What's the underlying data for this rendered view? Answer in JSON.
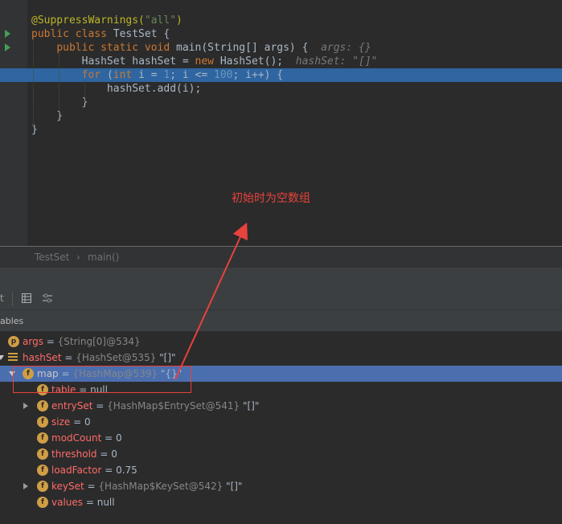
{
  "editor": {
    "lines": [
      {
        "segs": [
          [
            "ann",
            "@SuppressWarnings("
          ],
          [
            "str",
            "\"all\""
          ],
          [
            "ann",
            ")"
          ]
        ]
      },
      {
        "segs": [
          [
            "k",
            "public class "
          ],
          [
            "cls",
            "TestSet "
          ],
          [
            "plain",
            "{"
          ]
        ],
        "run": true
      },
      {
        "segs": [
          [
            "plain",
            "    "
          ],
          [
            "k",
            "public static void "
          ],
          [
            "fn",
            "main"
          ],
          [
            "plain",
            "("
          ],
          [
            "cls",
            "String"
          ],
          [
            "plain",
            "[] args) {  "
          ],
          [
            "hint",
            "args: {}"
          ]
        ],
        "run": true
      },
      {
        "segs": [
          [
            "plain",
            "        "
          ],
          [
            "cls",
            "HashSet"
          ],
          [
            "plain",
            " hashSet = "
          ],
          [
            "k",
            "new "
          ],
          [
            "cls",
            "HashSet"
          ],
          [
            "plain",
            "();  "
          ],
          [
            "hint",
            "hashSet: \"[]\""
          ]
        ]
      },
      {
        "segs": [
          [
            "plain",
            "        "
          ],
          [
            "k",
            "for "
          ],
          [
            "plain",
            "("
          ],
          [
            "k",
            "int "
          ],
          [
            "plain",
            "i = "
          ],
          [
            "num",
            "1"
          ],
          [
            "plain",
            "; i <= "
          ],
          [
            "num",
            "100"
          ],
          [
            "plain",
            "; i++) {"
          ]
        ],
        "highlight": true,
        "breakpoint": true
      },
      {
        "segs": [
          [
            "plain",
            "            hashSet."
          ],
          [
            "fn",
            "add"
          ],
          [
            "plain",
            "(i);"
          ]
        ]
      },
      {
        "segs": [
          [
            "plain",
            "        }"
          ]
        ]
      },
      {
        "segs": [
          [
            "plain",
            "    }"
          ]
        ]
      },
      {
        "segs": [
          [
            "plain",
            "}"
          ]
        ]
      }
    ]
  },
  "annotation": "初始时为空数组",
  "breadcrumb": {
    "class": "TestSet",
    "sep": "›",
    "method": "main()"
  },
  "variables_header": "ables",
  "tree": [
    {
      "indent": 0,
      "exp": "none",
      "icon": "p",
      "name": "args",
      "eq": " = ",
      "ref": "{String[0]@534}",
      "val": "",
      "red": true
    },
    {
      "indent": 0,
      "exp": "none",
      "icon": "lines",
      "name": "hashSet",
      "eq": " = ",
      "ref": "{HashSet@535}",
      "val": " \"[]\"",
      "red": true
    },
    {
      "indent": 1,
      "exp": "down",
      "icon": "f",
      "name": "map",
      "eq": " = ",
      "ref": "{HashMap@539}",
      "val": " \"{}\"",
      "red": false,
      "selected": true
    },
    {
      "indent": 2,
      "exp": "none",
      "icon": "f",
      "name": "table",
      "eq": " = ",
      "ref": "",
      "val": "null",
      "red": true
    },
    {
      "indent": 2,
      "exp": "right",
      "icon": "f",
      "name": "entrySet",
      "eq": " = ",
      "ref": "{HashMap$EntrySet@541}",
      "val": " \"[]\"",
      "red": true
    },
    {
      "indent": 2,
      "exp": "none",
      "icon": "f",
      "name": "size",
      "eq": " = ",
      "ref": "",
      "val": "0",
      "red": true
    },
    {
      "indent": 2,
      "exp": "none",
      "icon": "f",
      "name": "modCount",
      "eq": " = ",
      "ref": "",
      "val": "0",
      "red": true
    },
    {
      "indent": 2,
      "exp": "none",
      "icon": "f",
      "name": "threshold",
      "eq": " = ",
      "ref": "",
      "val": "0",
      "red": true
    },
    {
      "indent": 2,
      "exp": "none",
      "icon": "f",
      "name": "loadFactor",
      "eq": " = ",
      "ref": "",
      "val": "0.75",
      "red": true
    },
    {
      "indent": 2,
      "exp": "right",
      "icon": "f",
      "name": "keySet",
      "eq": " = ",
      "ref": "{HashMap$KeySet@542}",
      "val": " \"[]\"",
      "red": true
    },
    {
      "indent": 2,
      "exp": "none",
      "icon": "f",
      "name": "values",
      "eq": " = ",
      "ref": "",
      "val": "null",
      "red": true
    }
  ],
  "colors": {
    "annotation": "#e8423c",
    "selection": "#4b6eaf",
    "current_line": "#2f65a0"
  },
  "icons": [
    "run-gutter-icon",
    "breakpoint-icon",
    "table-view-icon",
    "settings-icon",
    "expand-arrow-icon",
    "field-icon",
    "parameter-icon"
  ]
}
